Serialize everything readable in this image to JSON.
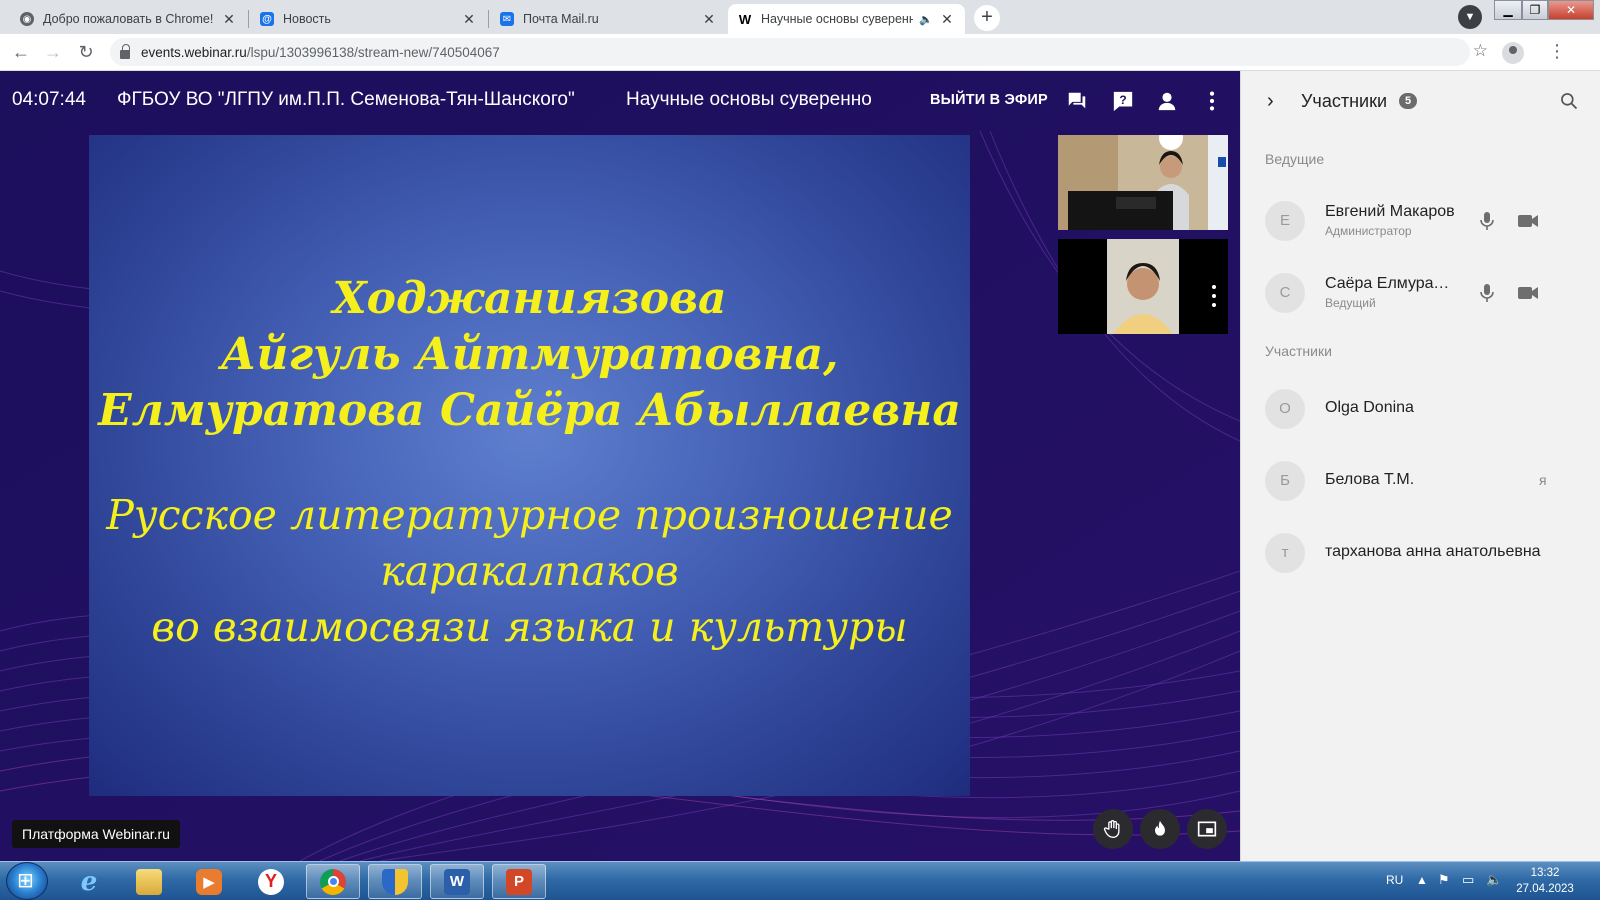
{
  "browser": {
    "tabs": [
      {
        "title": "Добро пожаловать в Chrome!",
        "icon": "chrome-icon",
        "active": false
      },
      {
        "title": "Новость",
        "icon": "mailru-at-icon",
        "active": false
      },
      {
        "title": "Почта Mail.ru",
        "icon": "mail-envelope-icon",
        "active": false
      },
      {
        "title": "Научные основы суверенно",
        "icon": "webinar-w-icon",
        "active": true
      }
    ],
    "url_host": "events.webinar.ru",
    "url_path": "/lspu/1303996138/stream-new/740504067"
  },
  "webinar": {
    "timer": "04:07:44",
    "organization": "ФГБОУ ВО \"ЛГПУ им.П.П. Семенова-Тян-Шанского\"",
    "event_title": "Научные основы суверенно",
    "exit_label": "ВЫЙТИ В ЭФИР",
    "platform_label": "Платформа Webinar.ru"
  },
  "slide": {
    "names_line1": "Ходжаниязова",
    "names_line2": "Айгуль Айтмуратовна,",
    "names_line3": "Елмуратова Сайёра Абыллаевна",
    "topic_line1": "Русское литературное произношение",
    "topic_line2": "каракалпаков",
    "topic_line3": "во взаимосвязи языка и культуры",
    "text_color": "#f5f01c"
  },
  "participants": {
    "title": "Участники",
    "count": "5",
    "hosts_label": "Ведущие",
    "members_label": "Участники",
    "hosts": [
      {
        "initial": "Е",
        "name": "Евгений Макаров",
        "role": "Администратор"
      },
      {
        "initial": "С",
        "name": "Саёра Елмуратова",
        "role": "Ведущий"
      }
    ],
    "members": [
      {
        "initial": "O",
        "name": "Olga Donina",
        "extra": ""
      },
      {
        "initial": "Б",
        "name": "Белова Т.М.",
        "extra": "я"
      },
      {
        "initial": "т",
        "name": "тарханова анна анатольевна",
        "extra": ""
      }
    ]
  },
  "taskbar": {
    "language": "RU",
    "time": "13:32",
    "date": "27.04.2023"
  }
}
